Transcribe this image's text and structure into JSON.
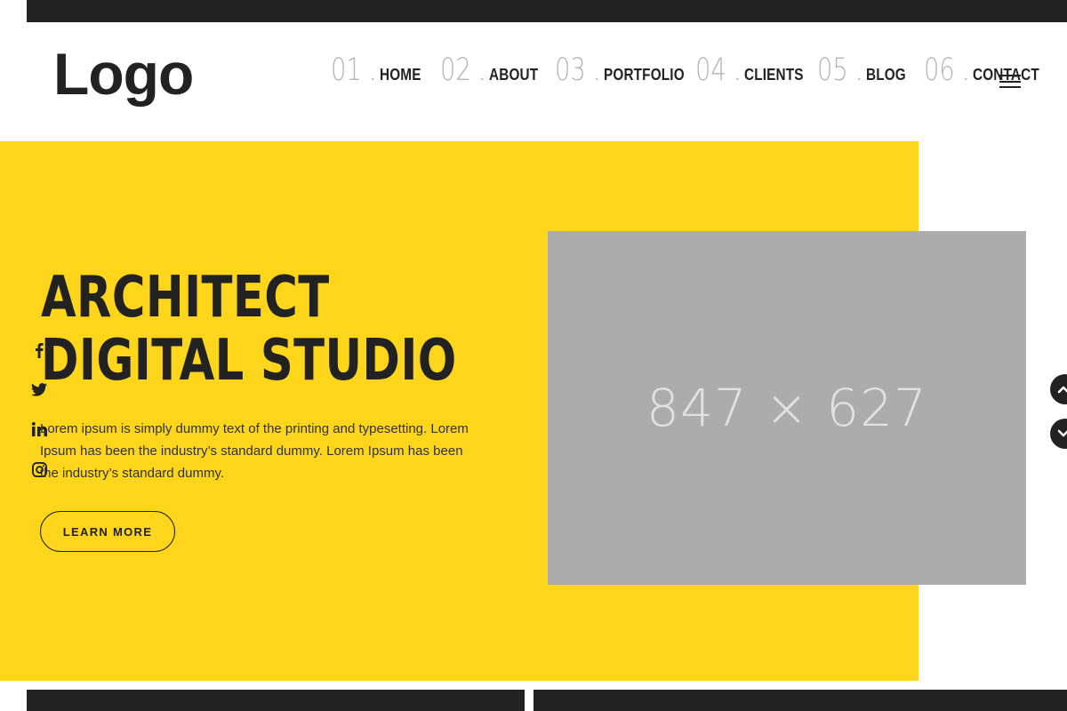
{
  "header": {
    "logo": "Logo",
    "nav": [
      {
        "num": "01",
        "label": "HOME"
      },
      {
        "num": "02",
        "label": "ABOUT"
      },
      {
        "num": "03",
        "label": "PORTFOLIO"
      },
      {
        "num": "04",
        "label": "CLIENTS"
      },
      {
        "num": "05",
        "label": "BLOG"
      },
      {
        "num": "06",
        "label": "CONTACT"
      }
    ],
    "nav_separator": ".",
    "menu_icon": "hamburger-menu-icon"
  },
  "hero": {
    "title_line1": "ARCHITECT",
    "title_line2": "DIGITAL STUDIO",
    "description": "Lorem ipsum is simply dummy text of the printing and typesetting. Lorem Ipsum has been the industry’s standard dummy. Lorem Ipsum has been the industry’s standard dummy.",
    "button_label": "LEARN MORE",
    "image_placeholder": "847 × 627",
    "social_icons": [
      "facebook-icon",
      "twitter-icon",
      "linkedin-icon",
      "instagram-icon"
    ]
  },
  "scroll": {
    "up_icon": "chevron-up-icon",
    "down_icon": "chevron-down-icon"
  },
  "colors": {
    "accent": "#fdd51b",
    "dark": "#222222",
    "placeholder_bg": "#acacac",
    "nav_number": "#b5b5b5"
  }
}
